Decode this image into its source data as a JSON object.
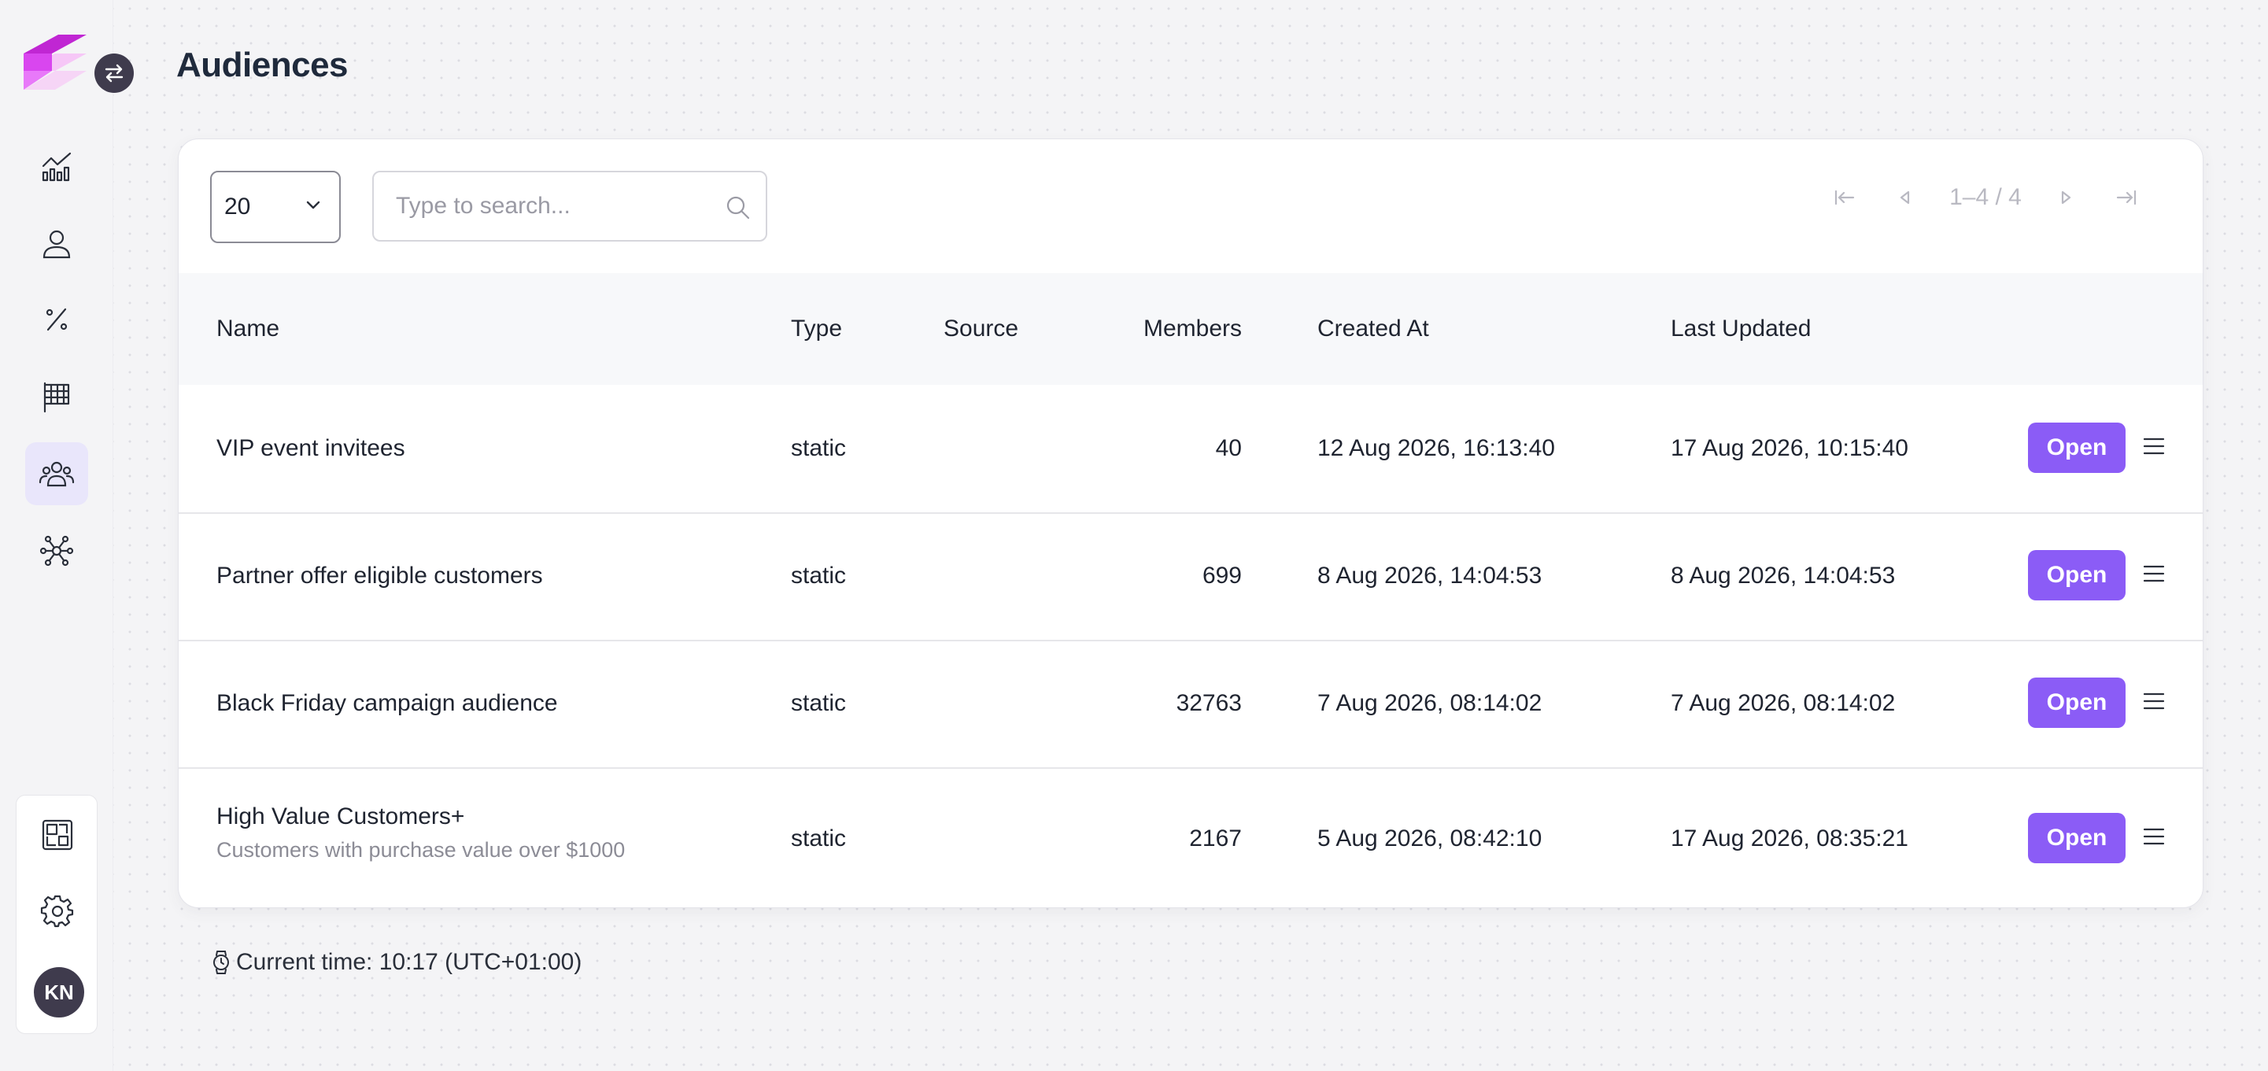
{
  "page": {
    "title": "Audiences"
  },
  "sidebar": {
    "nav": [
      {
        "icon": "analytics-icon"
      },
      {
        "icon": "user-icon"
      },
      {
        "icon": "percent-icon"
      },
      {
        "icon": "flag-icon"
      },
      {
        "icon": "audiences-icon",
        "active": true
      },
      {
        "icon": "network-icon"
      }
    ],
    "bottom": [
      {
        "icon": "extensions-icon"
      },
      {
        "icon": "gear-icon"
      }
    ],
    "avatar_initials": "KN"
  },
  "toolbar": {
    "page_size": "20",
    "search_placeholder": "Type to search...",
    "pagination": "1–4 / 4"
  },
  "table": {
    "columns": {
      "name": "Name",
      "type": "Type",
      "source": "Source",
      "members": "Members",
      "created": "Created At",
      "updated": "Last Updated"
    },
    "rows": [
      {
        "name": "VIP event invitees",
        "description": "",
        "type": "static",
        "source": "",
        "members": "40",
        "created": "12 Aug 2026, 16:13:40",
        "updated": "17 Aug 2026, 10:15:40",
        "action": "Open"
      },
      {
        "name": "Partner offer eligible customers",
        "description": "",
        "type": "static",
        "source": "",
        "members": "699",
        "created": "8 Aug 2026, 14:04:53",
        "updated": "8 Aug 2026, 14:04:53",
        "action": "Open"
      },
      {
        "name": "Black Friday campaign audience",
        "description": "",
        "type": "static",
        "source": "",
        "members": "32763",
        "created": "7 Aug 2026, 08:14:02",
        "updated": "7 Aug 2026, 08:14:02",
        "action": "Open"
      },
      {
        "name": "High Value Customers+",
        "description": "Customers with purchase value over $1000",
        "type": "static",
        "source": "",
        "members": "2167",
        "created": "5 Aug 2026, 08:42:10",
        "updated": "17 Aug 2026, 08:35:21",
        "action": "Open"
      }
    ]
  },
  "footer": {
    "current_time": "Current time: 10:17 (UTC+01:00)"
  },
  "colors": {
    "accent": "#8b5cf6",
    "logo_primary": "#c026d3",
    "logo_secondary": "#f0a8f3",
    "dark": "#3f3b4d"
  }
}
